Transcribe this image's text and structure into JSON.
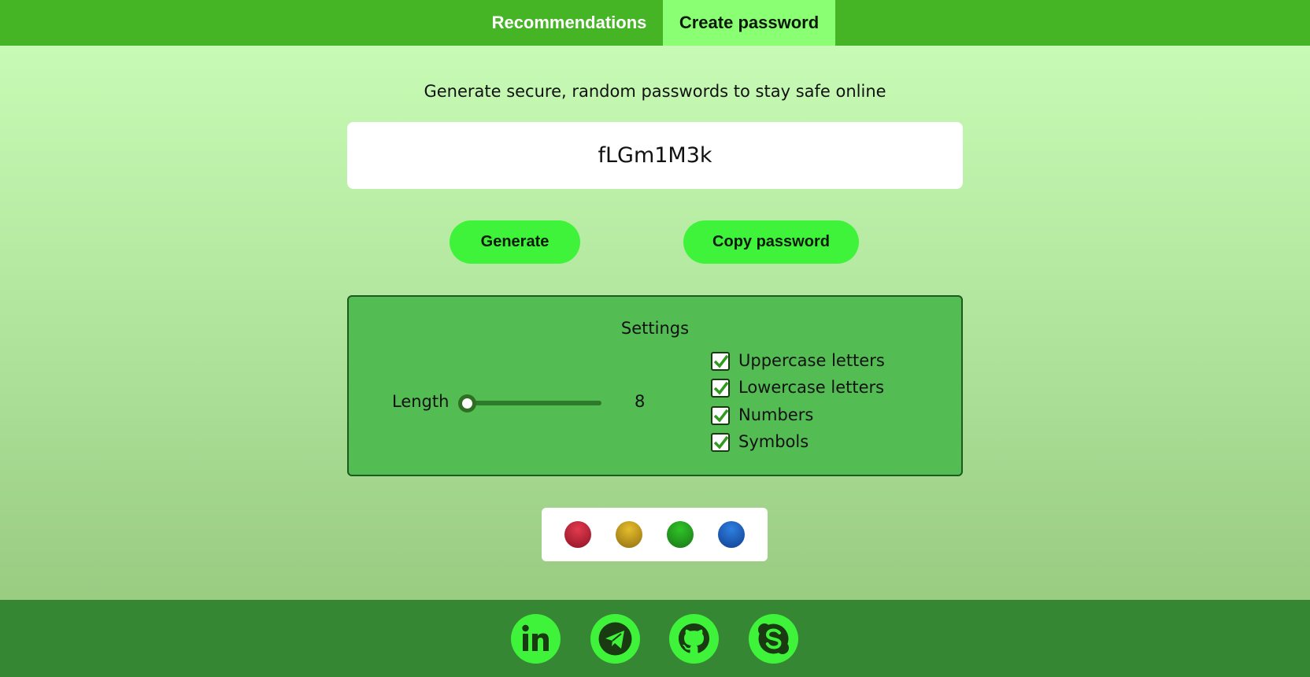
{
  "nav": {
    "tabs": [
      {
        "label": "Recommendations"
      },
      {
        "label": "Create password",
        "active": true
      }
    ]
  },
  "main": {
    "subtitle": "Generate secure, random passwords to stay safe online",
    "password": "fLGm1M3k",
    "buttons": {
      "generate": "Generate",
      "copy": "Copy password"
    }
  },
  "settings": {
    "title": "Settings",
    "length_label": "Length",
    "length_value": "8",
    "options": [
      {
        "label": "Uppercase letters",
        "checked": true
      },
      {
        "label": "Lowercase letters",
        "checked": true
      },
      {
        "label": "Numbers",
        "checked": true
      },
      {
        "label": "Symbols",
        "checked": true
      }
    ]
  },
  "themes": [
    {
      "name": "red-theme-dot",
      "color": "#c0213a"
    },
    {
      "name": "yellow-theme-dot",
      "color": "#c9a020"
    },
    {
      "name": "green-theme-dot",
      "color": "#26a11f"
    },
    {
      "name": "blue-theme-dot",
      "color": "#1f5fbf"
    }
  ],
  "footer": {
    "icons": [
      "linkedin-icon",
      "telegram-icon",
      "github-icon",
      "skype-icon"
    ]
  },
  "colors": {
    "nav": "#45b526",
    "active_tab": "#8bff73",
    "button": "#3ef33a",
    "settings_panel": "#53bc53",
    "footer": "#368734"
  }
}
